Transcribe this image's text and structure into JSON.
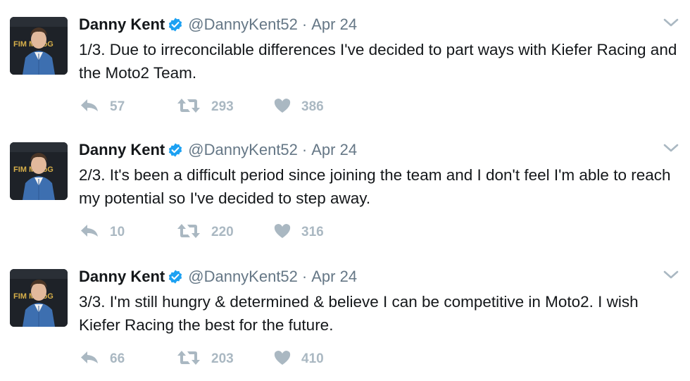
{
  "colors": {
    "verified": "#1da1f2",
    "action_icon": "#aab8c2",
    "meta_text": "#657786"
  },
  "tweets": [
    {
      "name": "Danny Kent",
      "handle": "@DannyKent52",
      "separator": "·",
      "date": "Apr 24",
      "text": "1/3. Due to irreconcilable differences I've decided to part ways with Kiefer Racing and the Moto2 Team.",
      "replies": "57",
      "retweets": "293",
      "likes": "386"
    },
    {
      "name": "Danny Kent",
      "handle": "@DannyKent52",
      "separator": "·",
      "date": "Apr 24",
      "text": "2/3. It's been a difficult period since joining the team and I don't feel I'm able to reach my potential so I've decided to step away.",
      "replies": "10",
      "retweets": "220",
      "likes": "316"
    },
    {
      "name": "Danny Kent",
      "handle": "@DannyKent52",
      "separator": "·",
      "date": "Apr 24",
      "text": "3/3. I'm still hungry & determined & believe I can be competitive in Moto2. I wish Kiefer Racing the best for the future.",
      "replies": "66",
      "retweets": "203",
      "likes": "410"
    }
  ],
  "avatar_backdrop_text": "FIM MotoG",
  "icons": {
    "reply": "reply-icon",
    "retweet": "retweet-icon",
    "like": "heart-icon",
    "verified": "verified-badge-icon",
    "caret": "chevron-down-icon"
  }
}
